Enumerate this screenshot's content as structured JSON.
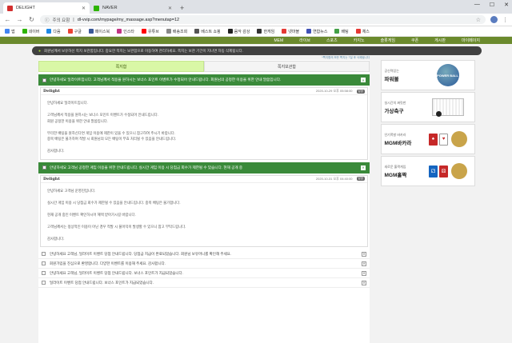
{
  "browser": {
    "tabs": [
      {
        "label": "DELIGHT",
        "color": "#d32f2f"
      },
      {
        "label": "NAVER",
        "color": "#2db400"
      }
    ],
    "address": {
      "security": "주의 요함",
      "url": "dl-vvip.com/mypage/my_massage.asp?menutap=12"
    },
    "bookmarks": [
      {
        "label": "앱",
        "color": "#4285f4"
      },
      {
        "label": "네이버",
        "color": "#2db400"
      },
      {
        "label": "다음",
        "color": "#1e88e5"
      },
      {
        "label": "구글",
        "color": "#ea4335"
      },
      {
        "label": "페이스북",
        "color": "#3b5998"
      },
      {
        "label": "인스타",
        "color": "#c13584"
      },
      {
        "label": "유튜브",
        "color": "#ff0000"
      },
      {
        "label": "배송조회",
        "color": "#888888"
      },
      {
        "label": "베스트 쇼핑",
        "color": "#555555"
      },
      {
        "label": "음악 감상",
        "color": "#222222"
      },
      {
        "label": "한게임",
        "color": "#333333"
      },
      {
        "label": "넷마블",
        "color": "#e53935"
      },
      {
        "label": "연합뉴스",
        "color": "#3f51b5"
      },
      {
        "label": "배팅",
        "color": "#43a047"
      },
      {
        "label": "체스",
        "color": "#e53935"
      }
    ]
  },
  "site_nav": [
    "MEM",
    "라이브",
    "스포츠",
    "카지노",
    "슬롯게임",
    "쿠폰",
    "게시판",
    "마이페이지"
  ],
  "notice": "회원님께서 보유하신 쪽지 보관함입니다. 중요한 쪽지는 보관함으로 이동하여 관리하세요. 쪽지는 보관 기간이 지나면 자동 삭제됩니다.",
  "notice_right": "*쪽지함의 모든 쪽지는 7일 후 삭제됩니다",
  "message_tabs": {
    "received": "쪽지함",
    "saved": "쪽지보관함"
  },
  "messages": [
    {
      "title": "안녕하세요 딜라이트입니다. 고객님께서 적용을 원하시는 보너스 포인트 이벤트가 수정되어 안내드립니다. 회원님의 공정한 이용을 위한 안내 말씀입니다.",
      "logo": "Delight",
      "date": "2020-10-29 오후 05:58:00",
      "reply": "답장",
      "body": [
        "안녕하세요 딜라이트입니다.",
        "",
        "고객님께서 적용을 원하시는 보너스 포인트 이벤트가 수정되어 안내드립니다.",
        "회원 공정한 이용을 위한 안내 말씀입니다.",
        "",
        "무리한 배팅을 원하신다면 게임 이용에 제한이 있을 수 있으니 참고하여 주시기 바랍니다.",
        "중복 배팅은 불가하며 적발 시 회원님의 모든 배팅이 무효 처리될 수 있음을 안내드립니다.",
        "",
        "감사합니다."
      ]
    },
    {
      "title": "안녕하세요 고객님 공정한 게임 이용을 위한 안내드립니다. 실시간 게임 이용 시 당첨금 회수가 제한될 수 있습니다. 현재 공개 중",
      "logo": "Delight",
      "date": "2020-10-31 오후 04:40:00",
      "reply": "답장",
      "body": [
        "안녕하세요 고객님 운영진입니다.",
        "",
        "실시간 게임 이용 시 당첨금 회수가 제한될 수 있음을 안내드립니다. 중복 배팅은 불가합니다.",
        "",
        "현재 공개 중인 이벤트 확인하시어 혜택 받아가시길 바랍니다.",
        "",
        "고객님께서는 정상적인 이용이 아닌 경우 적발 시 불이익이 발생할 수 있으니 참고 부탁드립니다.",
        "",
        "감사합니다."
      ]
    }
  ],
  "list": [
    "안녕하세요 고객님, 딜라이트 이벤트 당첨 안내드립니다. 당첨금 지급이 완료되었습니다. 회원님 보유머니를 확인해 주세요.",
    "회원가입을 진심으로 환영합니다. 다양한 이벤트를 이용해 주세요. 감사합니다.",
    "안녕하세요 고객님, 딜라이트 이벤트 당첨 안내드립니다. 보너스 포인트가 지급되었습니다.",
    "딜라이트 이벤트 당첨 안내드립니다. 보너스 포인트가 지급되었습니다."
  ],
  "banners": [
    {
      "small": "공신력있는",
      "big": "파워볼",
      "art": "POWER BALL"
    },
    {
      "small": "실시간의 짜릿한",
      "big": "가상축구"
    },
    {
      "small": "인기폭발 바카라",
      "big": "MGM바카라"
    },
    {
      "small": "새로운 홀짝게임",
      "big": "MGM홀짝"
    }
  ]
}
